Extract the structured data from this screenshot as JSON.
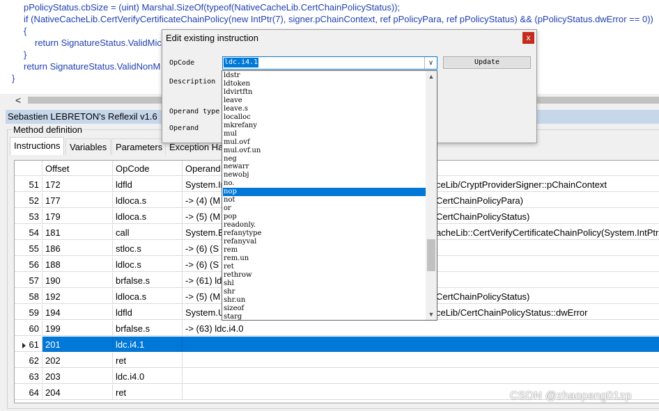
{
  "code_lines": [
    "pPolicyStatus.cbSize = (uint) Marshal.SizeOf(typeof(NativeCacheLib.CertChainPolicyStatus));",
    "if (NativeCacheLib.CertVerifyCertificateChainPolicy(new IntPtr(7), signer.pChainContext, ref pPolicyPara, ref pPolicyStatus) && (pPolicyStatus.dwError == 0))",
    "{",
    "return SignatureStatus.ValidMic",
    "}",
    "return SignatureStatus.ValidNonM",
    "}"
  ],
  "banner": {
    "title": "Sebastien LEBRETON's Reflexil v1.6"
  },
  "method_definition": {
    "legend": "Method definition"
  },
  "tabs": [
    "Instructions",
    "Variables",
    "Parameters",
    "Exception Ha"
  ],
  "grid": {
    "headers": [
      "",
      "Offset",
      "OpCode",
      "Operand"
    ],
    "rows": [
      {
        "index": "51",
        "offset": "172",
        "opcode": "ldfld",
        "operand": "System.IntPtr NativeCacheLib/CryptProviderSigner::pChainContext",
        "operand_left": "System.In",
        "operand_right": "ceLib/CryptProviderSigner::pChainContext"
      },
      {
        "index": "52",
        "offset": "177",
        "opcode": "ldloca.s",
        "operand_left": "-> (4)  (M",
        "operand_right": "CertChainPolicyPara)"
      },
      {
        "index": "53",
        "offset": "179",
        "opcode": "ldloca.s",
        "operand_left": "-> (5)  (M",
        "operand_right": "CertChainPolicyStatus)"
      },
      {
        "index": "54",
        "offset": "181",
        "opcode": "call",
        "operand_left": "System.B",
        "operand_right": "acheLib::CertVerifyCertificateChainPolicy(System.IntPtr,Sy"
      },
      {
        "index": "55",
        "offset": "186",
        "opcode": "stloc.s",
        "operand_left": "-> (6)  (S",
        "operand_right": ""
      },
      {
        "index": "56",
        "offset": "188",
        "opcode": "ldloc.s",
        "operand_left": "-> (6)  (S",
        "operand_right": ""
      },
      {
        "index": "57",
        "offset": "190",
        "opcode": "brfalse.s",
        "operand_left": "-> (61) ld",
        "operand_right": ""
      },
      {
        "index": "58",
        "offset": "192",
        "opcode": "ldloca.s",
        "operand_left": "-> (5)  (M",
        "operand_right": "CertChainPolicyStatus)"
      },
      {
        "index": "59",
        "offset": "194",
        "opcode": "ldfld",
        "operand_left": "System.U",
        "operand_right": "ceLib/CertChainPolicyStatus::dwError"
      },
      {
        "index": "60",
        "offset": "199",
        "opcode": "brfalse.s",
        "operand_left": "-> (63) ldc.i4.0",
        "operand_right": ""
      },
      {
        "index": "61",
        "offset": "201",
        "opcode": "ldc.i4.1",
        "operand_left": "",
        "operand_right": "",
        "selected": true
      },
      {
        "index": "62",
        "offset": "202",
        "opcode": "ret",
        "operand_left": "",
        "operand_right": ""
      },
      {
        "index": "63",
        "offset": "203",
        "opcode": "ldc.i4.0",
        "operand_left": "",
        "operand_right": ""
      },
      {
        "index": "64",
        "offset": "204",
        "opcode": "ret",
        "operand_left": "",
        "operand_right": ""
      }
    ]
  },
  "dialog": {
    "title": "Edit existing instruction",
    "close_glyph": "x",
    "labels": {
      "opcode": "OpCode",
      "description": "Description",
      "operand_type": "Operand type",
      "operand": "Operand"
    },
    "opcode_value": "ldc.i4.1",
    "combo_arrow": "∨",
    "update_label": "Update",
    "dropdown_items": [
      "ldstr",
      "ldtoken",
      "ldvirtftn",
      "leave",
      "leave.s",
      "localloc",
      "mkrefany",
      "mul",
      "mul.ovf",
      "mul.ovf.un",
      "neg",
      "newarr",
      "newobj",
      "no.",
      "nop",
      "not",
      "or",
      "pop",
      "readonly.",
      "refanytype",
      "refanyval",
      "rem",
      "rem.un",
      "ret",
      "rethrow",
      "shl",
      "shr",
      "shr.un",
      "sizeof",
      "starg"
    ],
    "dropdown_selected": "nop",
    "scroll_up": "▲",
    "scroll_down": "▼"
  },
  "scroll": {
    "left_arrow": "<"
  },
  "watermark": "CSDN @zhaopeng01zp"
}
